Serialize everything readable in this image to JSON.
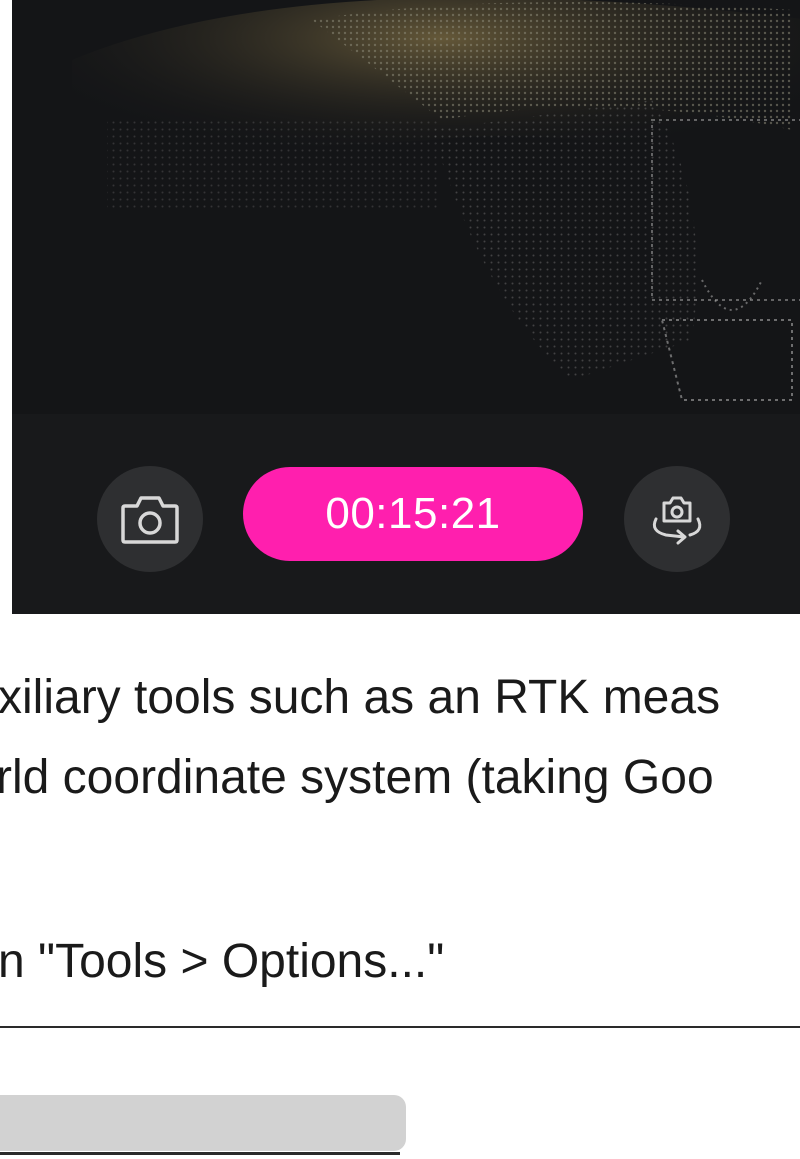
{
  "recorder": {
    "timer": "00:15:21",
    "capture_icon": "camera-icon",
    "switch_icon": "camera-switch-icon",
    "accent_color": "#ff1fae"
  },
  "article": {
    "line1": "xiliary tools such as an RTK meas",
    "line2": "rld coordinate system (taking Goo",
    "line3": "n \"Tools > Options...\""
  }
}
